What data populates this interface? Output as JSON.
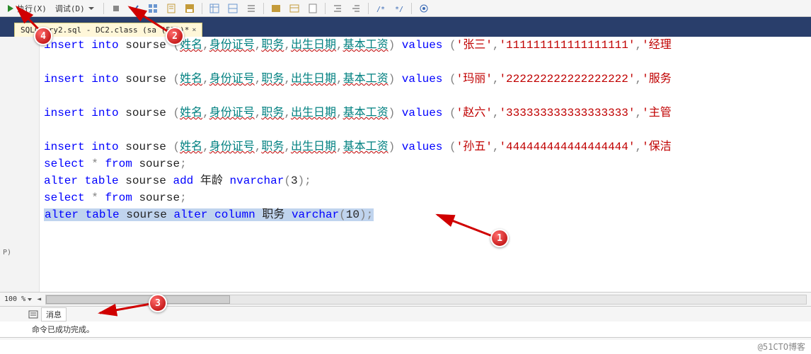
{
  "toolbar": {
    "execute_label": "执行(X)",
    "debug_label": "调试(D)"
  },
  "tab": {
    "title": "SQLQuery2.sql - DC2.class (sa (53))*"
  },
  "gutter": {
    "p_label": "P)"
  },
  "code": {
    "lines": [
      {
        "type": "insert",
        "values": [
          "'张三'",
          "'111111111111111111'",
          "'经理"
        ]
      },
      {
        "type": "blank"
      },
      {
        "type": "insert",
        "values": [
          "'玛丽'",
          "'222222222222222222'",
          "'服务"
        ]
      },
      {
        "type": "blank"
      },
      {
        "type": "insert",
        "values": [
          "'赵六'",
          "'333333333333333333'",
          "'主管"
        ]
      },
      {
        "type": "blank"
      },
      {
        "type": "insert",
        "values": [
          "'孙五'",
          "'444444444444444444'",
          "'保洁"
        ]
      },
      {
        "type": "select"
      },
      {
        "type": "alter_add"
      },
      {
        "type": "select"
      },
      {
        "type": "alter_col_hl"
      }
    ],
    "insert_kw": {
      "insert": "insert",
      "into": "into",
      "values": "values"
    },
    "sourse": "sourse",
    "cols": "(姓名,身份证号,职务,出生日期,基本工资)",
    "select_stmt": {
      "select": "select",
      "star": "*",
      "from": "from",
      "sourse": "sourse",
      "semi": ";"
    },
    "alter_add": {
      "alter": "alter",
      "table": "table",
      "sourse": "sourse",
      "add": "add",
      "col": "年龄",
      "type": "nvarchar",
      "lp": "(",
      "n": "3",
      "rp": ")",
      "semi": ";"
    },
    "alter_col": {
      "alter": "alter",
      "table": "table",
      "sourse": "sourse",
      "alter2": "alter",
      "column": "column",
      "col": "职务",
      "type": "varchar",
      "lp": "(",
      "n": "10",
      "rp": ")",
      "semi": ";"
    }
  },
  "zoom": {
    "percent": "100 %",
    "scroll_left": "◄"
  },
  "messages": {
    "tab_label": "消息",
    "success_text": "命令已成功完成。"
  },
  "markers": {
    "m1": "1",
    "m2": "2",
    "m3": "3",
    "m4": "4"
  },
  "footer": {
    "watermark": "@51CTO博客"
  }
}
